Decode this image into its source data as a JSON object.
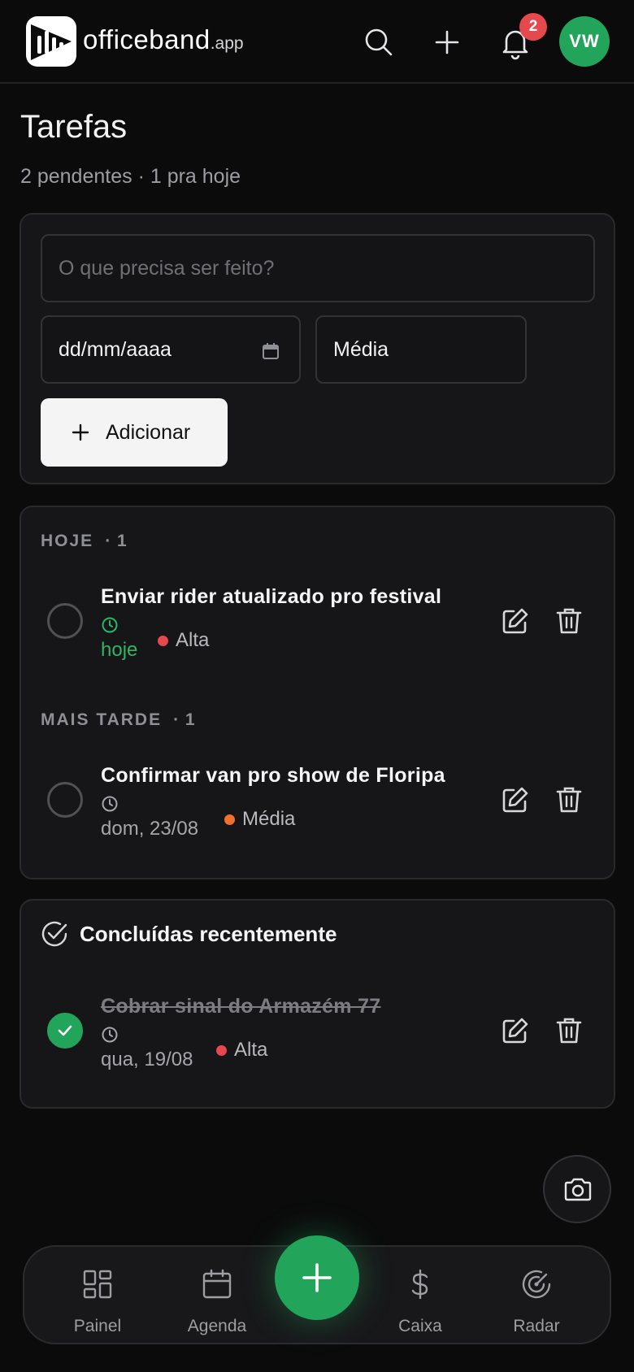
{
  "header": {
    "brand_name": "officeband",
    "brand_suffix": ".app",
    "notification_count": "2",
    "avatar_initials": "VW"
  },
  "page": {
    "title": "Tarefas",
    "subtitle": "2 pendentes · 1 pra hoje"
  },
  "new_task": {
    "title_placeholder": "O que precisa ser feito?",
    "date_placeholder": "dd/mm/aaaa",
    "priority_value": "Média",
    "add_label": "Adicionar"
  },
  "sections": {
    "today": {
      "label": "HOJE",
      "count": "· 1"
    },
    "later": {
      "label": "MAIS TARDE",
      "count": "· 1"
    }
  },
  "tasks": [
    {
      "title": "Enviar rider atualizado pro festival",
      "date": "hoje",
      "priority": "Alta",
      "priority_color": "#e5484d",
      "done": false
    },
    {
      "title": "Confirmar van pro show de Floripa",
      "date": "dom, 23/08",
      "priority": "Média",
      "priority_color": "#f0702e",
      "done": false
    }
  ],
  "completed": {
    "heading": "Concluídas recentemente",
    "tasks": [
      {
        "title": "Cobrar sinal do Armazém 77",
        "date": "qua, 19/08",
        "priority": "Alta",
        "priority_color": "#e5484d",
        "done": true
      }
    ]
  },
  "nav": {
    "items": [
      {
        "label": "Painel",
        "icon": "dashboard-icon"
      },
      {
        "label": "Agenda",
        "icon": "calendar-icon"
      },
      {
        "label": "Caixa",
        "icon": "dollar-icon"
      },
      {
        "label": "Radar",
        "icon": "radar-icon"
      }
    ]
  },
  "colors": {
    "accent": "#22a55a",
    "danger": "#e5484d",
    "warning": "#f0702e",
    "background": "#0b0b0c"
  }
}
